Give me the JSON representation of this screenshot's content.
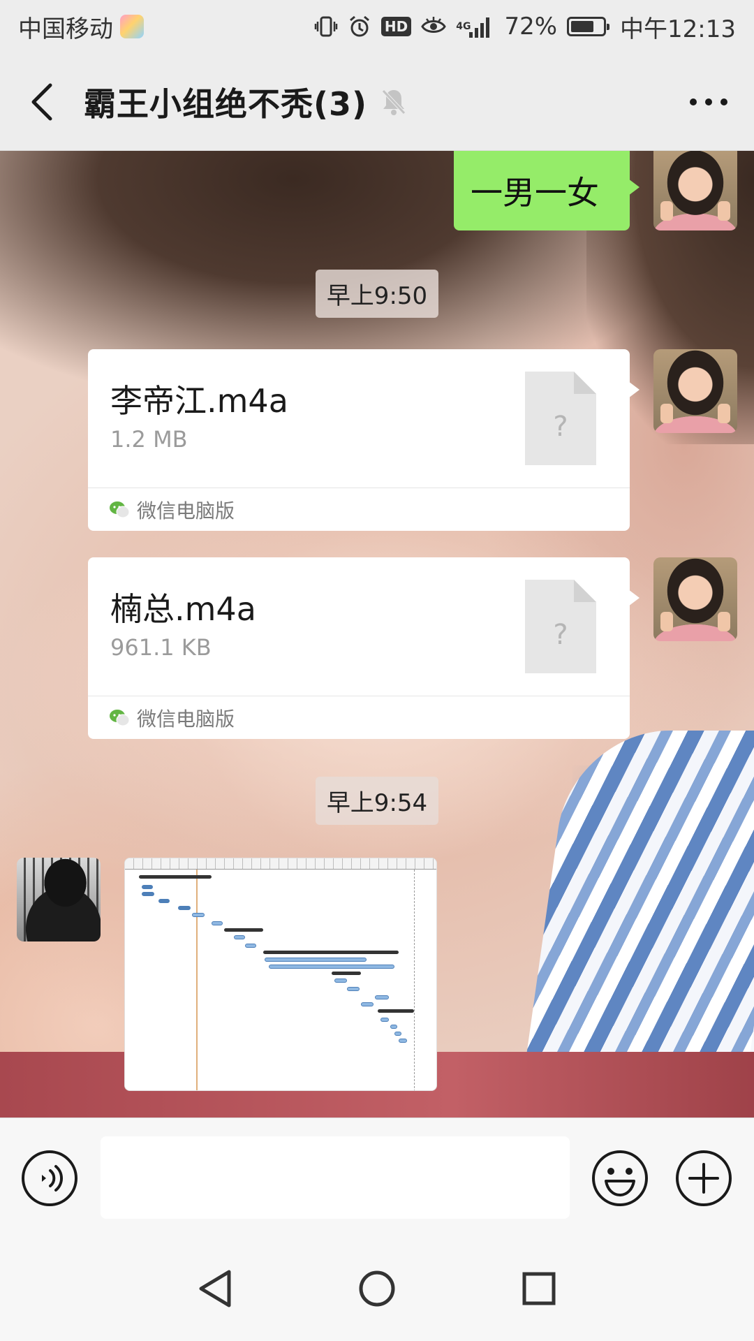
{
  "status_bar": {
    "carrier": "中国移动",
    "network_label": "4G",
    "hd_label": "HD",
    "battery_percent": "72%",
    "battery_level": 0.72,
    "time": "中午12:13"
  },
  "header": {
    "title": "霸王小组绝不秃(3)",
    "muted": true,
    "icons": {
      "back": "back-arrow-icon",
      "mute": "bell-off-icon",
      "more": "more-dots-icon"
    }
  },
  "messages": [
    {
      "type": "text",
      "side": "right",
      "text": "一男一女"
    },
    {
      "type": "timestamp",
      "text": "早上9:50"
    },
    {
      "type": "file",
      "side": "right",
      "file_name": "李帝江.m4a",
      "file_size": "1.2 MB",
      "source": "微信电脑版",
      "file_icon_symbol": "?"
    },
    {
      "type": "file",
      "side": "right",
      "file_name": "楠总.m4a",
      "file_size": "961.1 KB",
      "source": "微信电脑版",
      "file_icon_symbol": "?"
    },
    {
      "type": "timestamp",
      "text": "早上9:54"
    },
    {
      "type": "image",
      "side": "left",
      "content": "gantt-chart-screenshot"
    }
  ],
  "input_bar": {
    "placeholder": "",
    "value": "",
    "icons": {
      "voice": "voice-icon",
      "emoji": "emoji-icon",
      "plus": "plus-icon"
    }
  },
  "nav_bar": {
    "icons": {
      "back": "nav-back-icon",
      "home": "nav-home-icon",
      "recents": "nav-recents-icon"
    }
  },
  "colors": {
    "bubble_self": "#95ec69",
    "chrome_background": "#ededed",
    "file_card_background": "#ffffff"
  }
}
